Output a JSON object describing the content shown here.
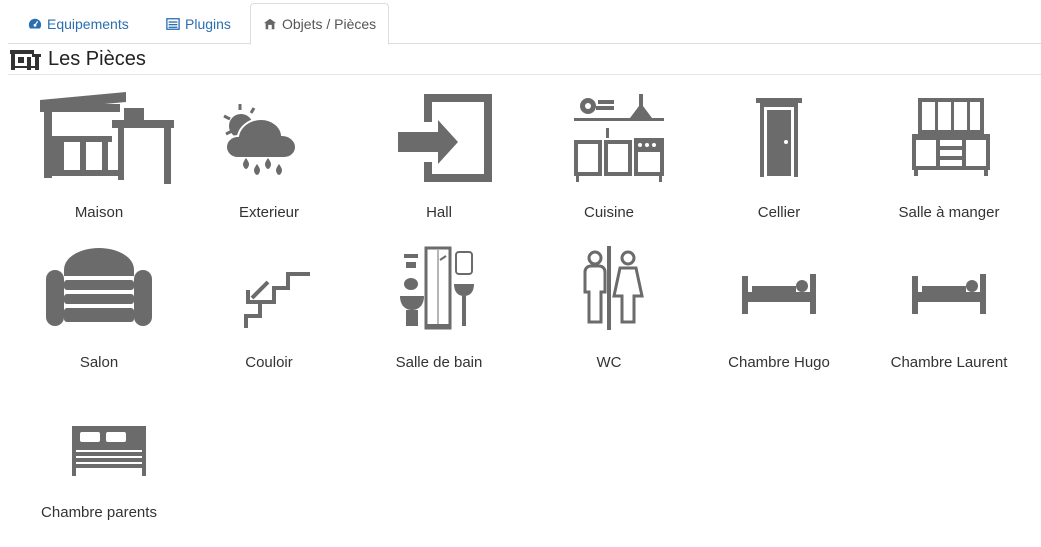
{
  "tabs": [
    {
      "label": "Equipements",
      "icon": "dashboard-icon",
      "active": false
    },
    {
      "label": "Plugins",
      "icon": "list-icon",
      "active": false
    },
    {
      "label": "Objets / Pièces",
      "icon": "house-icon",
      "active": true
    }
  ],
  "section": {
    "title": "Les Pièces",
    "icon": "house-icon"
  },
  "rooms": [
    {
      "label": "Maison",
      "icon": "house-icon"
    },
    {
      "label": "Exterieur",
      "icon": "weather-icon"
    },
    {
      "label": "Hall",
      "icon": "door-enter-icon"
    },
    {
      "label": "Cuisine",
      "icon": "kitchen-icon"
    },
    {
      "label": "Cellier",
      "icon": "door-icon"
    },
    {
      "label": "Salle à manger",
      "icon": "cupboard-icon"
    },
    {
      "label": "Salon",
      "icon": "sofa-icon"
    },
    {
      "label": "Couloir",
      "icon": "stairs-icon"
    },
    {
      "label": "Salle de bain",
      "icon": "bathroom-icon"
    },
    {
      "label": "WC",
      "icon": "wc-icon"
    },
    {
      "label": "Chambre Hugo",
      "icon": "single-bed-icon"
    },
    {
      "label": "Chambre Laurent",
      "icon": "single-bed-icon"
    },
    {
      "label": "Chambre parents",
      "icon": "double-bed-icon"
    }
  ],
  "colors": {
    "icon": "#6b6b6b",
    "link": "#2a6fb0"
  }
}
